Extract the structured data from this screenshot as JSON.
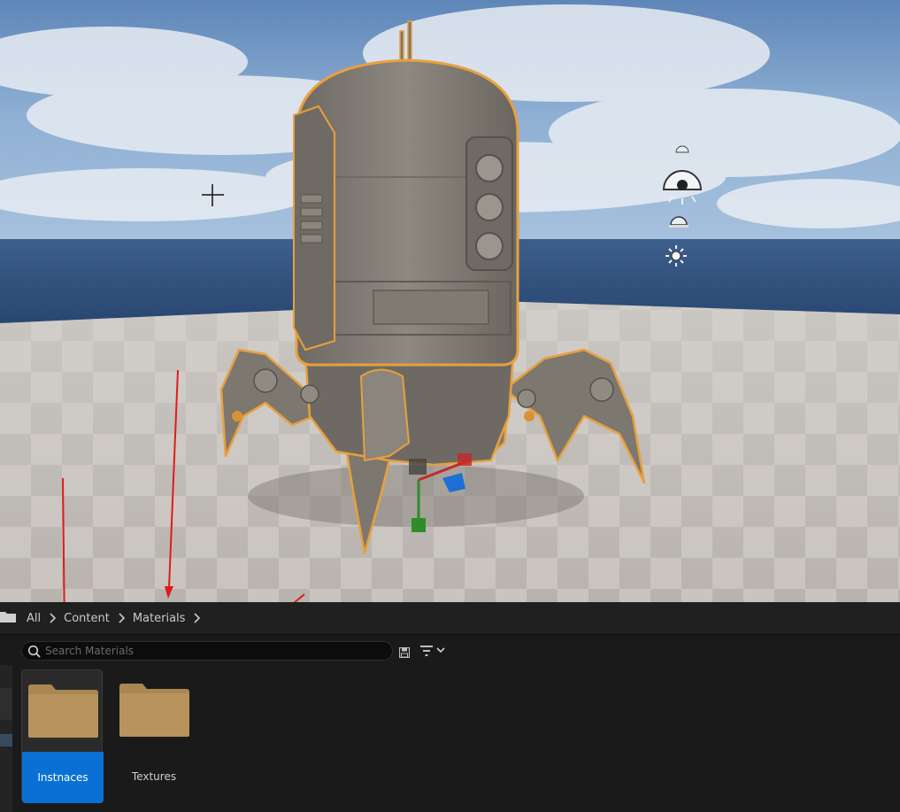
{
  "breadcrumb": {
    "items": [
      "All",
      "Content",
      "Materials"
    ]
  },
  "search": {
    "placeholder": "Search Materials",
    "value": ""
  },
  "assets": [
    {
      "label": "Instnaces",
      "type": "folder",
      "selected": true
    },
    {
      "label": "Textures",
      "type": "folder",
      "selected": false
    }
  ],
  "colors": {
    "selection": "#0a70d6",
    "folder": "#b8935e",
    "selection_outline": "#e8a03c",
    "annotation": "#e01b1b"
  },
  "icons": {
    "folder": "folder-icon",
    "search": "search-icon",
    "save": "save-icon",
    "filter": "filter-icon",
    "chevron": "chevron-right-icon",
    "light": "directional-light-icon",
    "sky": "sky-light-icon",
    "sun": "sun-icon"
  }
}
